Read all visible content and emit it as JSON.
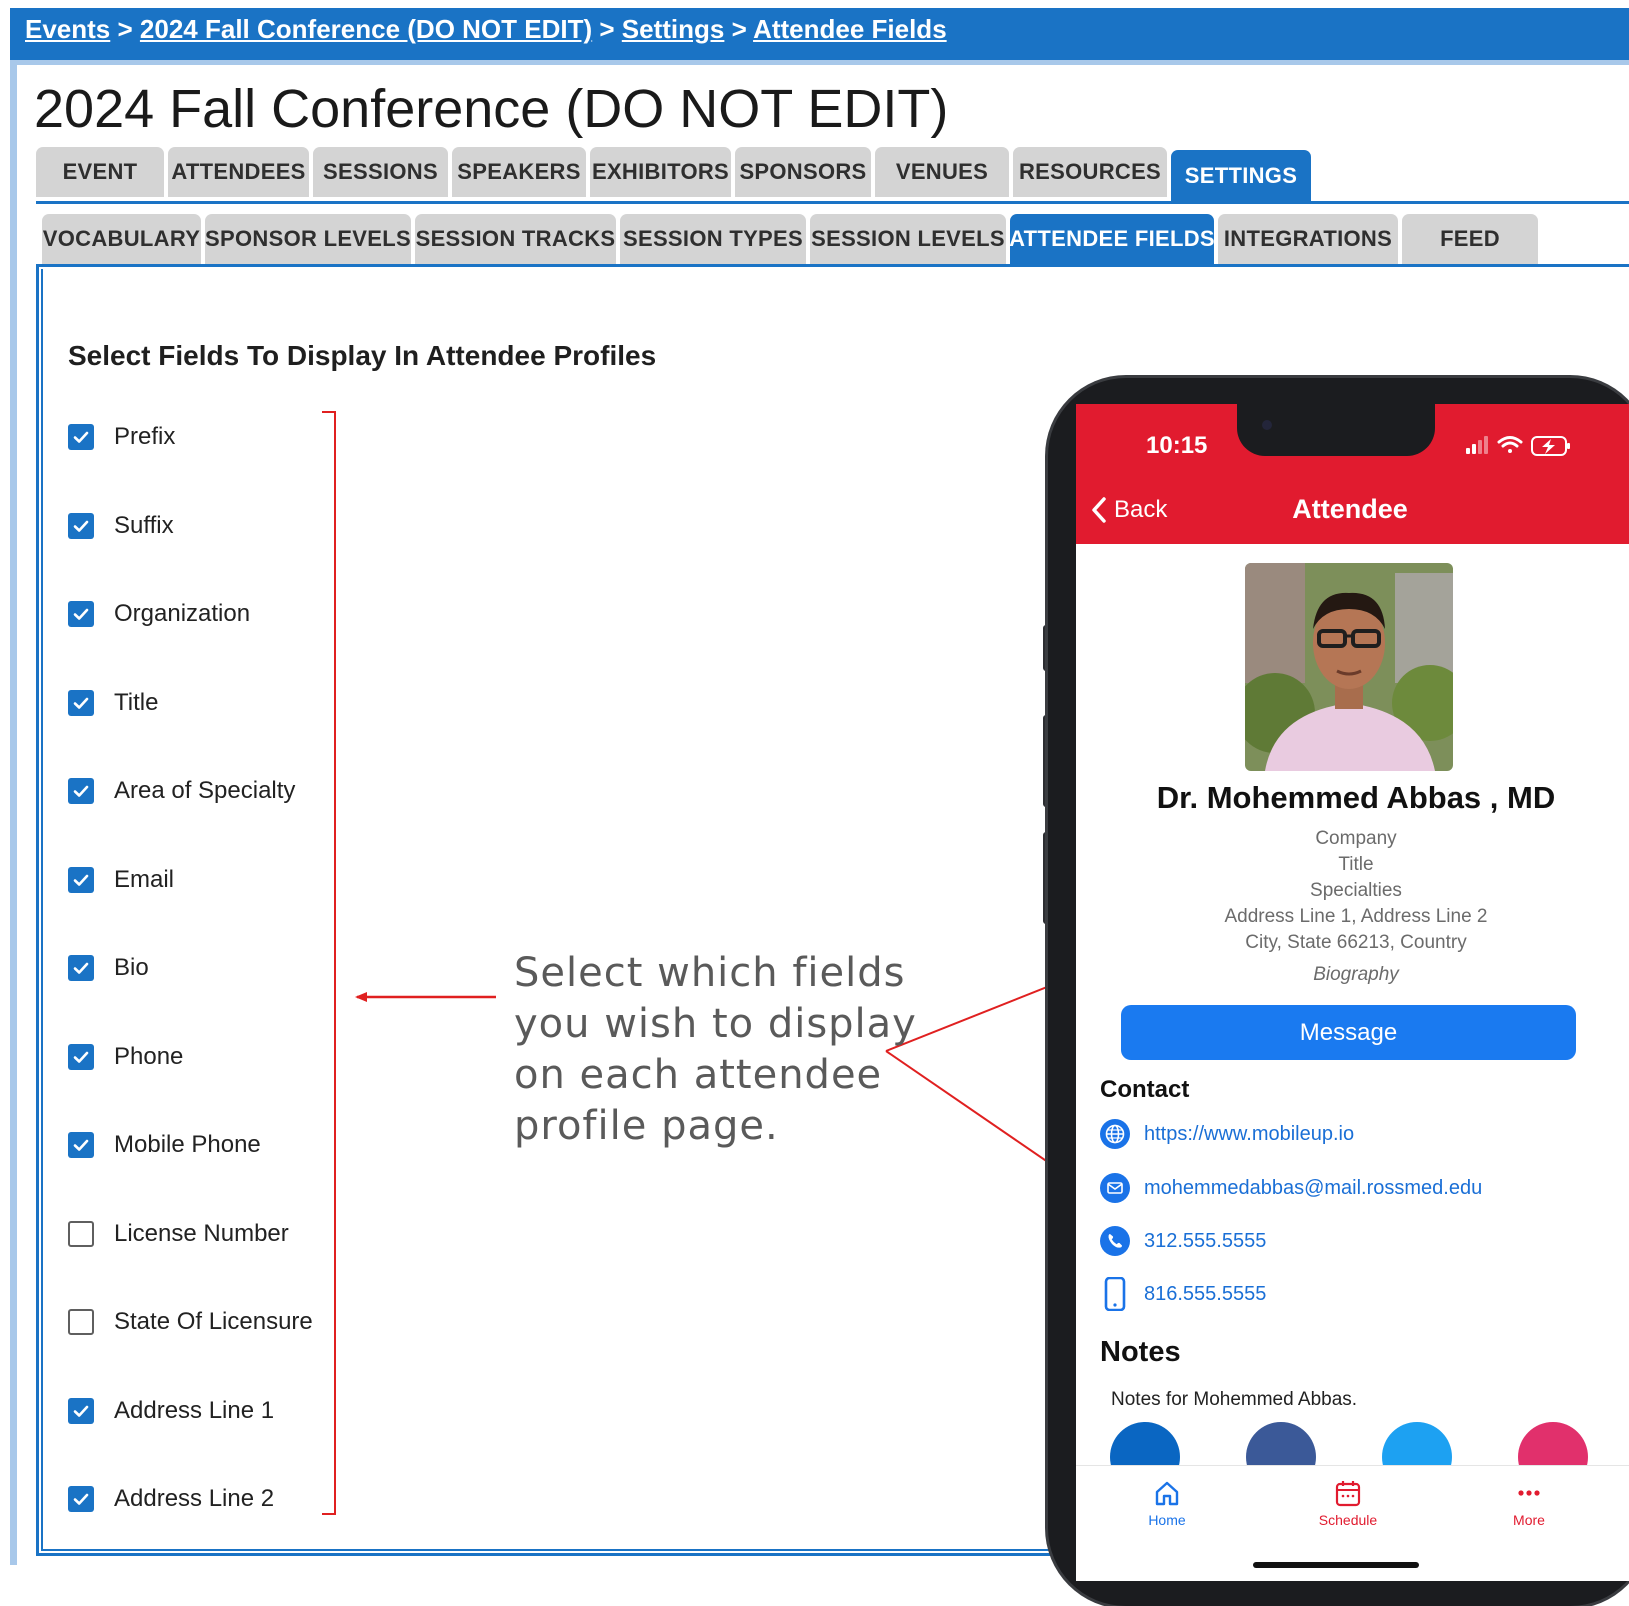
{
  "breadcrumb": {
    "items": [
      "Events",
      "2024 Fall Conference (DO NOT EDIT)",
      "Settings",
      "Attendee Fields"
    ],
    "separator": ">"
  },
  "page_title": "2024 Fall Conference (DO NOT EDIT)",
  "main_tabs": [
    "EVENT",
    "ATTENDEES",
    "SESSIONS",
    "SPEAKERS",
    "EXHIBITORS",
    "SPONSORS",
    "VENUES",
    "RESOURCES",
    "SETTINGS"
  ],
  "main_tab_active": "SETTINGS",
  "sub_tabs": [
    "VOCABULARY",
    "SPONSOR LEVELS",
    "SESSION TRACKS",
    "SESSION TYPES",
    "SESSION LEVELS",
    "ATTENDEE FIELDS",
    "INTEGRATIONS",
    "FEED"
  ],
  "sub_tab_active": "ATTENDEE FIELDS",
  "section_heading": "Select Fields To Display In Attendee Profiles",
  "fields": [
    {
      "label": "Prefix",
      "checked": true
    },
    {
      "label": "Suffix",
      "checked": true
    },
    {
      "label": "Organization",
      "checked": true
    },
    {
      "label": "Title",
      "checked": true
    },
    {
      "label": "Area of Specialty",
      "checked": true
    },
    {
      "label": "Email",
      "checked": true
    },
    {
      "label": "Bio",
      "checked": true
    },
    {
      "label": "Phone",
      "checked": true
    },
    {
      "label": "Mobile Phone",
      "checked": true
    },
    {
      "label": "License Number",
      "checked": false
    },
    {
      "label": "State Of Licensure",
      "checked": false
    },
    {
      "label": "Address Line 1",
      "checked": true
    },
    {
      "label": "Address Line 2",
      "checked": true
    }
  ],
  "callout": {
    "lines": [
      "Select which fields",
      "you wish to display",
      "on each attendee",
      "profile page."
    ]
  },
  "phone": {
    "time": "10:15",
    "nav": {
      "back": "Back",
      "title": "Attendee"
    },
    "profile": {
      "name": "Dr. Mohemmed Abbas , MD",
      "company": "Company",
      "title": "Title",
      "specialties": "Specialties",
      "address1": "Address Line 1, Address Line 2",
      "address2": "City, State 66213, Country",
      "biography": "Biography"
    },
    "message_button": "Message",
    "contact_heading": "Contact",
    "contact": {
      "website": "https://www.mobileup.io",
      "email": "mohemmedabbas@mail.rossmed.edu",
      "phone": "312.555.5555",
      "mobile": "816.555.5555"
    },
    "notes_heading": "Notes",
    "notes_text": "Notes for Mohemmed Abbas.",
    "tabbar": {
      "home": "Home",
      "schedule": "Schedule",
      "more": "More"
    }
  },
  "colors": {
    "primary_blue": "#1a73c5",
    "tab_gray": "#d4d4d4",
    "app_red": "#e11b2f",
    "annotation_red": "#e02020",
    "link_blue": "#1a6fd6",
    "message_blue": "#1a7af0"
  }
}
